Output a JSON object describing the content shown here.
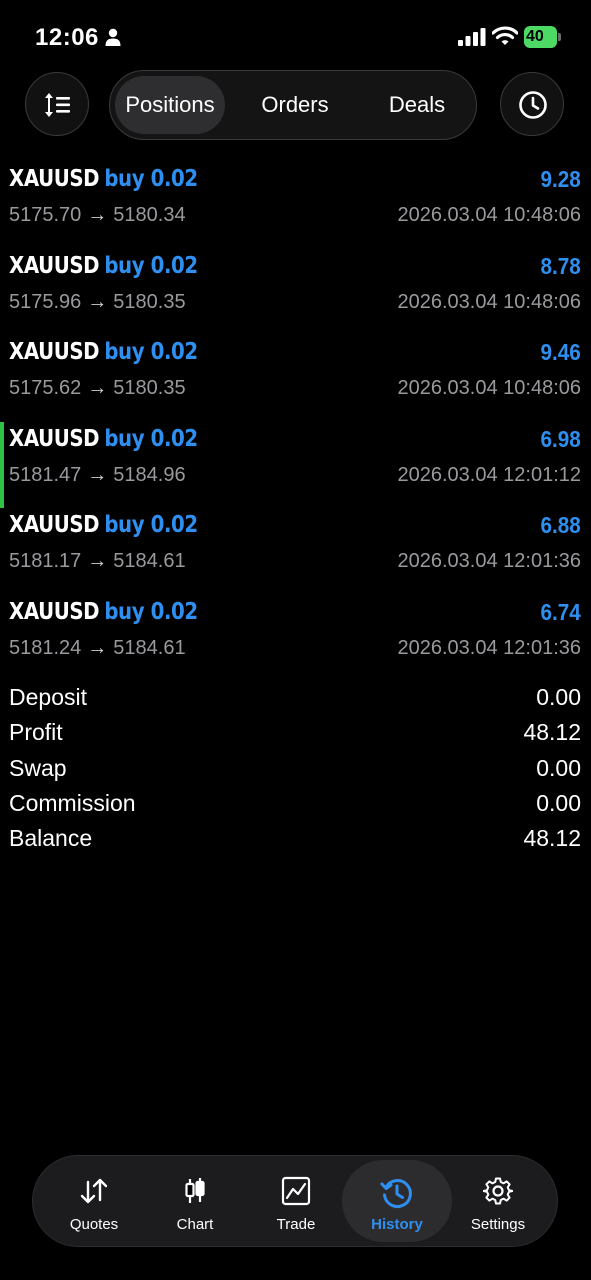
{
  "status_bar": {
    "time": "12:06",
    "battery": "40"
  },
  "segments": {
    "positions": "Positions",
    "orders": "Orders",
    "deals": "Deals",
    "active": "positions"
  },
  "positions": [
    {
      "symbol": "XAUUSD",
      "side": "buy 0.02",
      "profit": "9.28",
      "open": "5175.70",
      "arrow": "→",
      "close": "5180.34",
      "datetime": "2026.03.04 10:48:06"
    },
    {
      "symbol": "XAUUSD",
      "side": "buy 0.02",
      "profit": "8.78",
      "open": "5175.96",
      "arrow": "→",
      "close": "5180.35",
      "datetime": "2026.03.04 10:48:06"
    },
    {
      "symbol": "XAUUSD",
      "side": "buy 0.02",
      "profit": "9.46",
      "open": "5175.62",
      "arrow": "→",
      "close": "5180.35",
      "datetime": "2026.03.04 10:48:06"
    },
    {
      "symbol": "XAUUSD",
      "side": "buy 0.02",
      "profit": "6.98",
      "open": "5181.47",
      "arrow": "→",
      "close": "5184.96",
      "datetime": "2026.03.04 12:01:12"
    },
    {
      "symbol": "XAUUSD",
      "side": "buy 0.02",
      "profit": "6.88",
      "open": "5181.17",
      "arrow": "→",
      "close": "5184.61",
      "datetime": "2026.03.04 12:01:36"
    },
    {
      "symbol": "XAUUSD",
      "side": "buy 0.02",
      "profit": "6.74",
      "open": "5181.24",
      "arrow": "→",
      "close": "5184.61",
      "datetime": "2026.03.04 12:01:36"
    }
  ],
  "summary": [
    {
      "label": "Deposit",
      "value": "0.00"
    },
    {
      "label": "Profit",
      "value": "48.12"
    },
    {
      "label": "Swap",
      "value": "0.00"
    },
    {
      "label": "Commission",
      "value": "0.00"
    },
    {
      "label": "Balance",
      "value": "48.12"
    }
  ],
  "tabbar": {
    "quotes": "Quotes",
    "chart": "Chart",
    "trade": "Trade",
    "history": "History",
    "settings": "Settings",
    "active": "history"
  },
  "colors": {
    "accent": "#2f8ff0",
    "highlight_marker": "#2fc247",
    "battery": "#4cd964",
    "background": "#000000"
  },
  "icons": [
    "person-icon",
    "signal-icon",
    "wifi-icon",
    "sort-icon",
    "clock-icon",
    "quotes-icon",
    "chart-candles-icon",
    "trade-icon",
    "history-icon",
    "gear-icon"
  ]
}
